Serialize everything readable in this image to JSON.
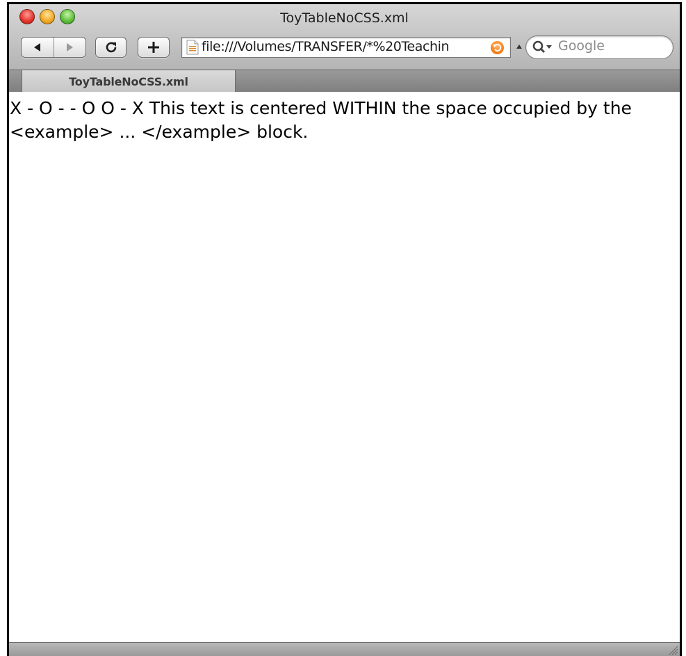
{
  "window": {
    "title": "ToyTableNoCSS.xml"
  },
  "toolbar": {
    "back_icon": "back-arrow-icon",
    "forward_icon": "forward-arrow-icon",
    "reload_icon": "reload-icon",
    "add_bookmark_icon": "plus-icon"
  },
  "address_bar": {
    "url": "file:///Volumes/TRANSFER/*%20Teachin"
  },
  "search": {
    "placeholder": "Google"
  },
  "tabs": [
    {
      "label": "ToyTableNoCSS.xml"
    }
  ],
  "page": {
    "text": "X - O - - O O - X This text is centered WITHIN the space occupied by the <example> ... </example> block."
  }
}
